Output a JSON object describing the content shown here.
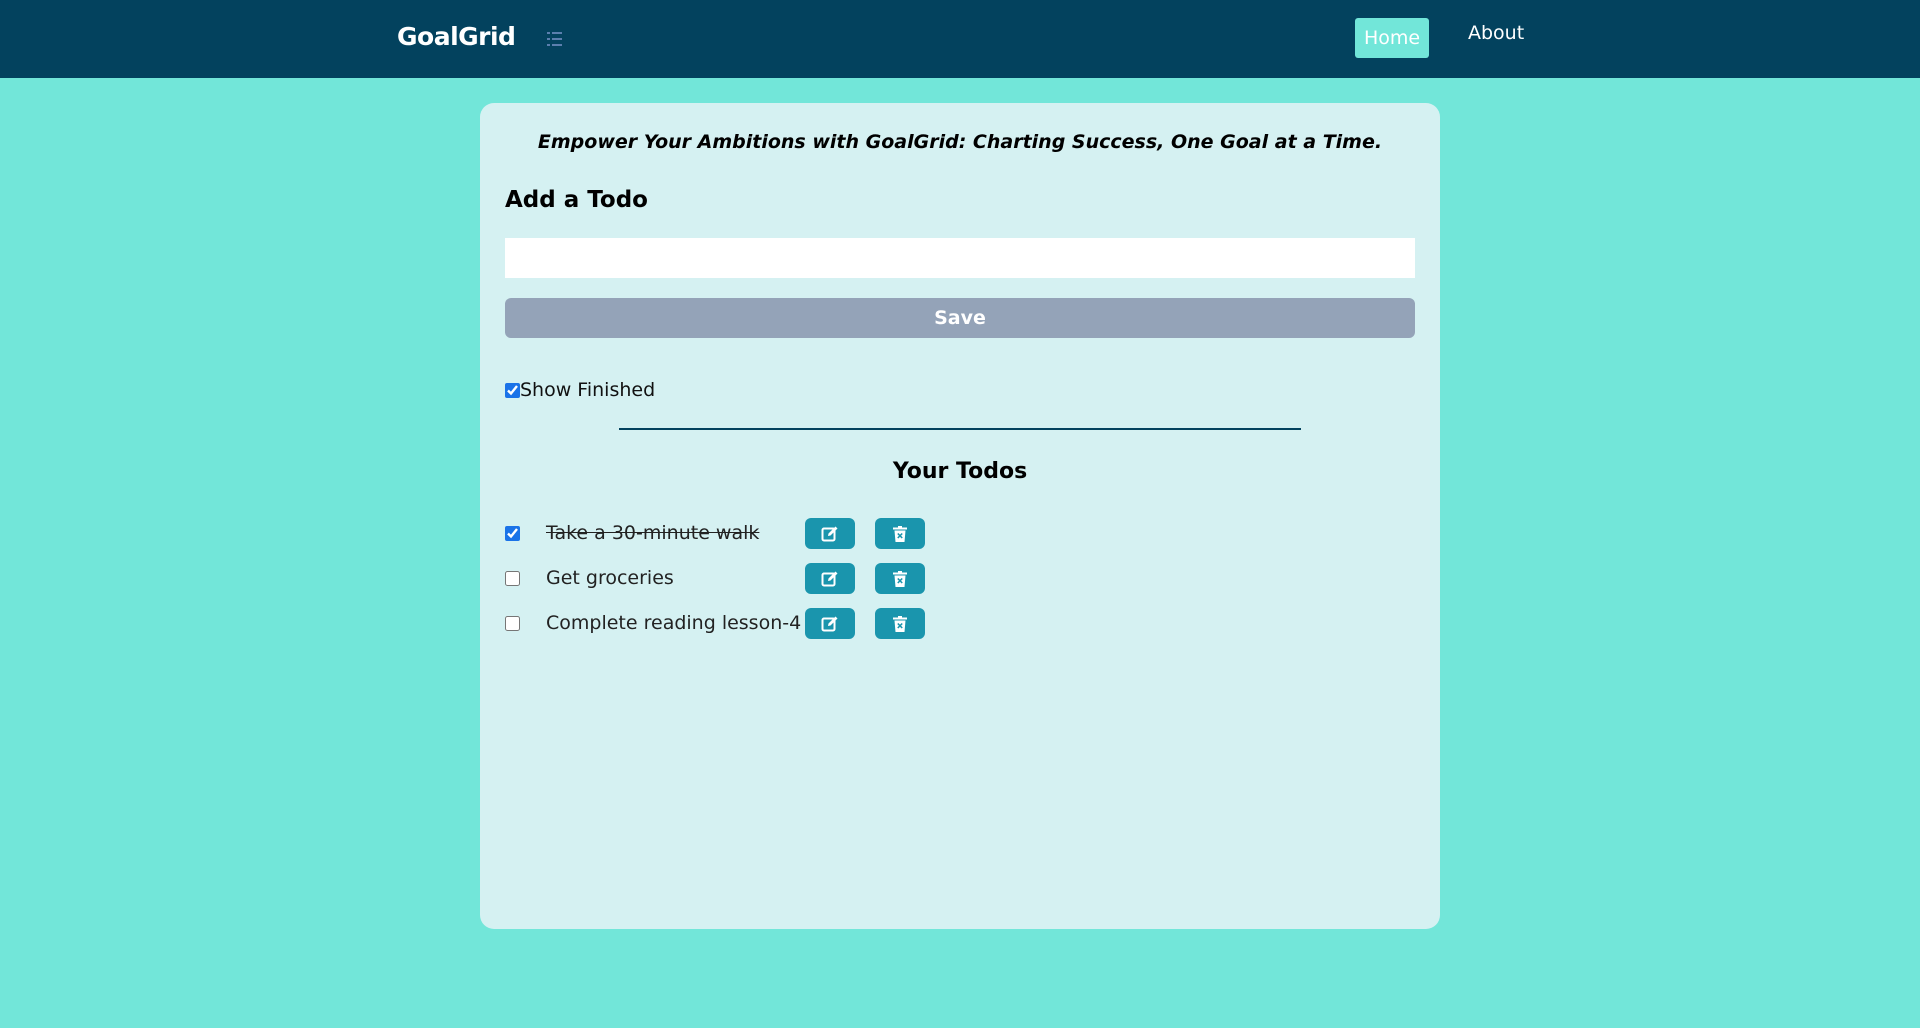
{
  "navbar": {
    "brand": "GoalGrid",
    "menu_icon": "list-icon",
    "links": [
      {
        "label": "Home",
        "active": true
      },
      {
        "label": "About",
        "active": false
      }
    ]
  },
  "main": {
    "tagline": "Empower Your Ambitions with GoalGrid: Charting Success, One Goal at a Time.",
    "add_heading": "Add a Todo",
    "input_value": "",
    "save_label": "Save",
    "show_finished": {
      "label": "Show Finished",
      "checked": true
    },
    "todos_heading": "Your Todos",
    "todos": [
      {
        "text": "Take a 30-minute walk",
        "done": true
      },
      {
        "text": "Get groceries",
        "done": false
      },
      {
        "text": "Complete reading lesson-4",
        "done": false
      }
    ]
  },
  "colors": {
    "background": "#72e6d9",
    "navbar": "#03425e",
    "card": "#d5f1f2",
    "save_button": "#94a3b8",
    "action_button": "#1a95ad"
  },
  "icons": {
    "edit": "edit-icon",
    "delete": "trash-icon"
  }
}
